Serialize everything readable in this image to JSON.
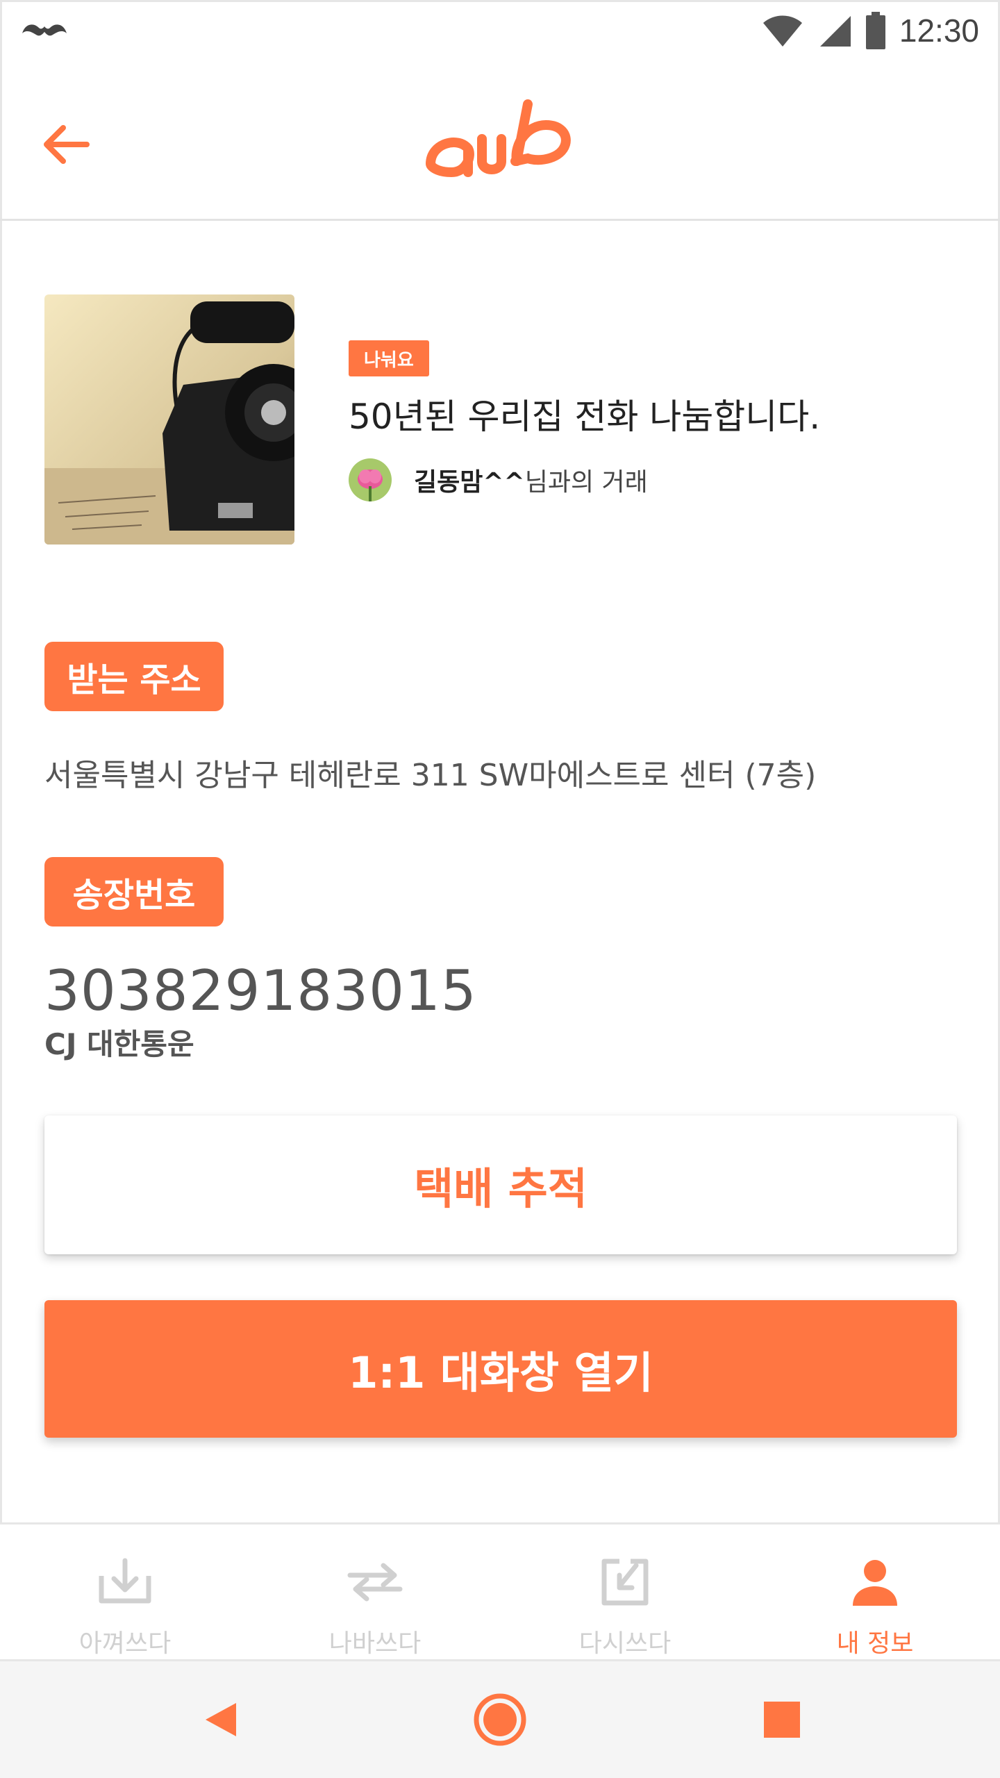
{
  "status_bar": {
    "time": "12:30",
    "icons": [
      "mustache-icon",
      "wifi-icon",
      "signal-icon",
      "battery-icon"
    ]
  },
  "header": {
    "logo_alt": "logo",
    "back_icon": "arrow-left-icon"
  },
  "item": {
    "tag": "나눠요",
    "title": "50년된 우리집 전화 나눔합니다.",
    "partner_name": "길동맘^^",
    "partner_suffix": "님과의 거래"
  },
  "address": {
    "label": "받는 주소",
    "value": "서울특별시 강남구 테헤란로 311 SW마에스트로 센터 (7층)"
  },
  "invoice": {
    "label": "송장번호",
    "number": "303829183015",
    "courier": "CJ 대한통운"
  },
  "buttons": {
    "track": "택배 추적",
    "chat": "1:1 대화창 열기"
  },
  "bottom_nav": {
    "items": [
      {
        "label": "아껴쓰다",
        "icon": "tray-download-icon",
        "active": false
      },
      {
        "label": "나바쓰다",
        "icon": "swap-arrows-icon",
        "active": false
      },
      {
        "label": "다시쓰다",
        "icon": "recycle-in-icon",
        "active": false
      },
      {
        "label": "내 정보",
        "icon": "person-icon",
        "active": true
      }
    ]
  },
  "colors": {
    "accent": "#ff7642",
    "inactive": "#d0d0d0",
    "text_secondary": "#555555"
  }
}
